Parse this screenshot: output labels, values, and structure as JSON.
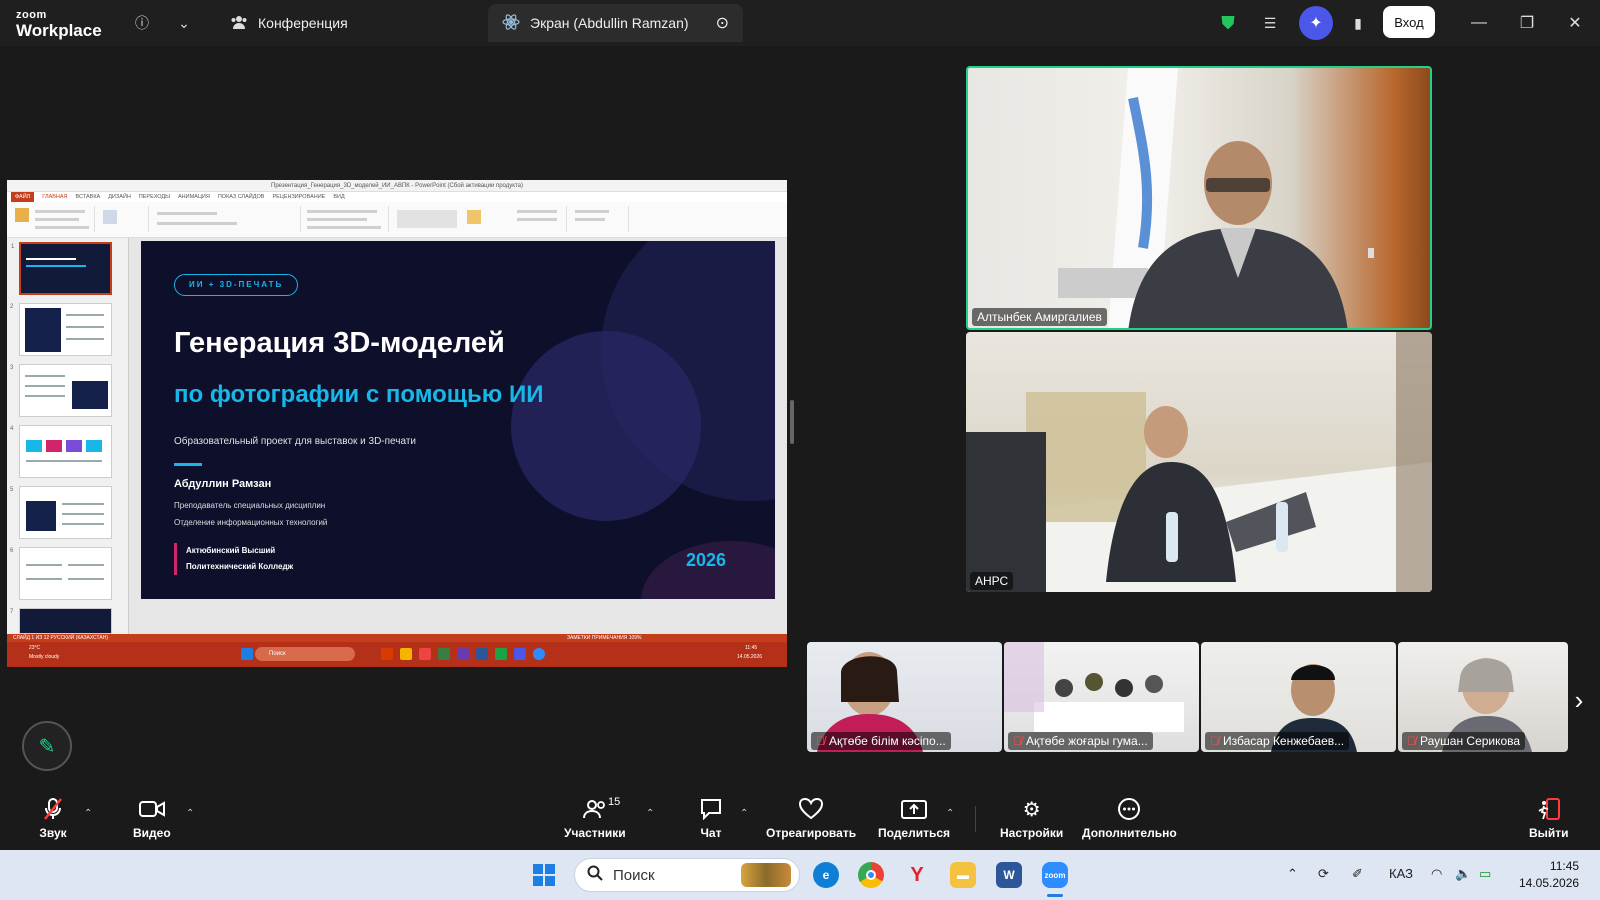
{
  "topbar": {
    "logo_line1": "zoom",
    "logo_line2": "Workplace",
    "conference_tab": "Конференция",
    "screen_tab": "Экран (Abdullin Ramzan)",
    "signin_label": "Вход"
  },
  "presentation": {
    "window_title": "Презентация_Генерация_3D_моделей_ИИ_АВПК - PowerPoint (Сбой активации продукта)",
    "ribbon_tabs": [
      "ФАЙЛ",
      "ГЛАВНАЯ",
      "ВСТАВКА",
      "ДИЗАЙН",
      "ПЕРЕХОДЫ",
      "АНИМАЦИЯ",
      "ПОКАЗ СЛАЙДОВ",
      "РЕЦЕНЗИРОВАНИЕ",
      "ВИД"
    ],
    "status_left": "СЛАЙД 1 ИЗ 12    РУССКИЙ (КАЗАХСТАН)",
    "status_right": "ЗАМЕТКИ   ПРИМЕЧАНИЯ   109%",
    "slide": {
      "badge": "ИИ + 3D-ПЕЧАТЬ",
      "title": "Генерация 3D-моделей",
      "subtitle": "по фотографии с помощью ИИ",
      "description": "Образовательный проект для выставок и 3D-печати",
      "author": "Абдуллин Рамзан",
      "role_line1": "Преподаватель специальных дисциплин",
      "role_line2": "Отделение информационных технологий",
      "college_line1": "Актюбинский Высший",
      "college_line2": "Политехнический Колледж",
      "year": "2026"
    },
    "thumbnail_numbers": [
      "1",
      "2",
      "3",
      "4",
      "5",
      "6",
      "7"
    ],
    "remote_weather_temp": "23°C",
    "remote_weather_desc": "Mostly cloudy",
    "remote_search": "Поиск",
    "remote_time": "11:45",
    "remote_date": "14.05.2026"
  },
  "participants": {
    "speaker": "Алтынбек Амиргалиев",
    "second": "АНРС",
    "strip": [
      "Ақтөбе білім кәсіпо...",
      "Ақтөбе жоғары гума...",
      "Избасар Кенжебаев...",
      "Раушан Серикова"
    ]
  },
  "toolbar": {
    "audio": "Звук",
    "video": "Видео",
    "participants": "Участники",
    "participants_count": "15",
    "chat": "Чат",
    "react": "Отреагировать",
    "share": "Поделиться",
    "settings": "Настройки",
    "more": "Дополнительно",
    "leave": "Выйти"
  },
  "taskbar": {
    "search_placeholder": "Поиск",
    "language": "КАЗ",
    "time": "11:45",
    "date": "14.05.2026"
  },
  "colors": {
    "accent_cyan": "#18b7e8",
    "speaker_border": "#23d18b",
    "ppt_red": "#c43e1c"
  }
}
